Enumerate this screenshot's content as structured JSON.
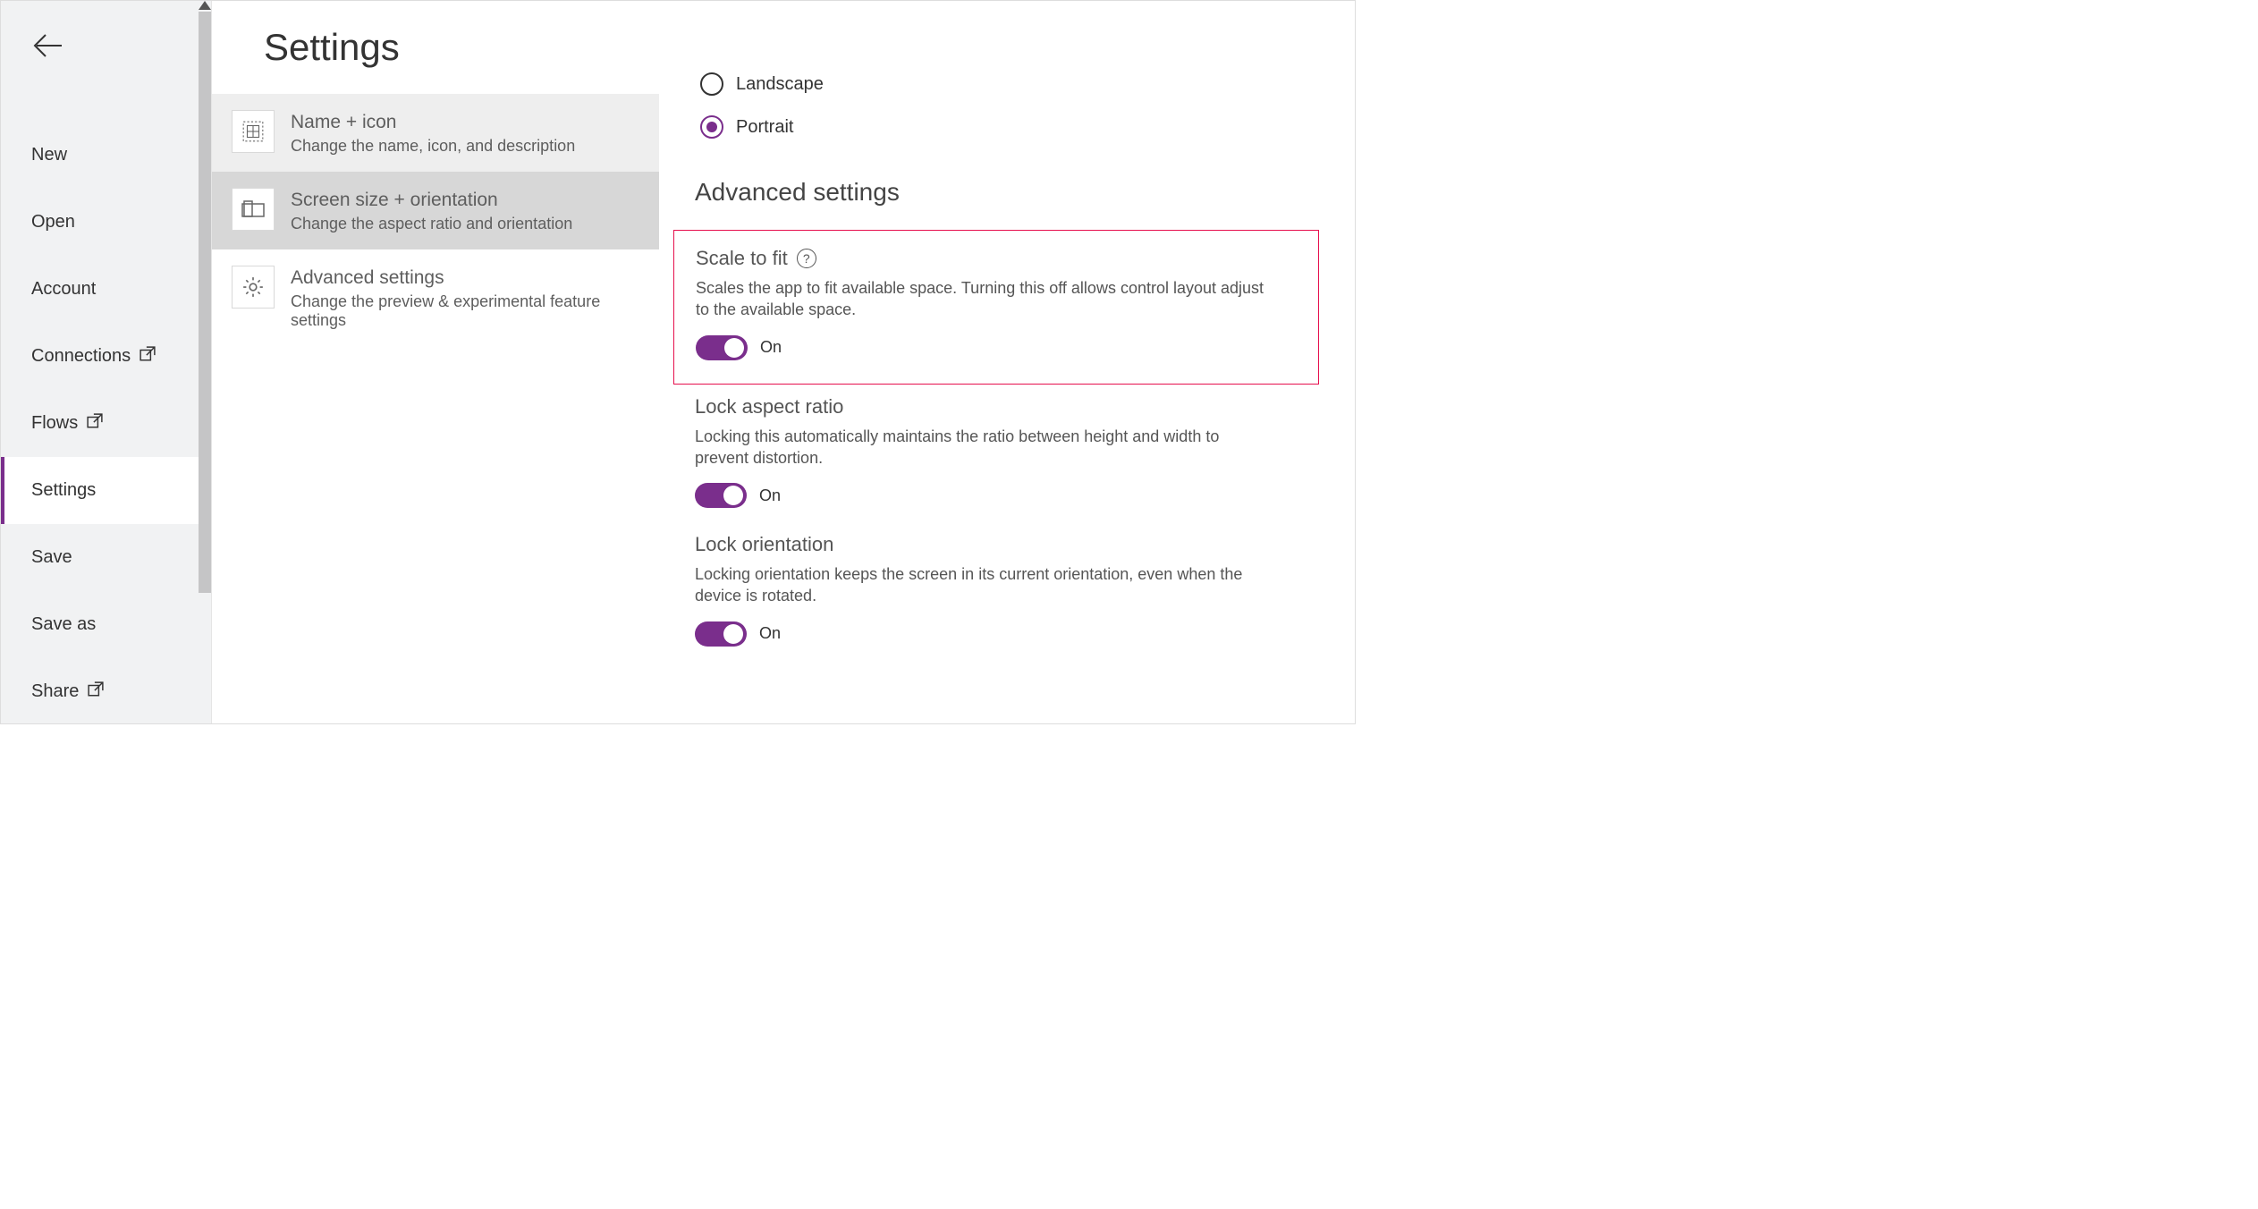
{
  "page_title": "Settings",
  "nav": {
    "items": [
      {
        "label": "New",
        "external": false
      },
      {
        "label": "Open",
        "external": false
      },
      {
        "label": "Account",
        "external": false
      },
      {
        "label": "Connections",
        "external": true
      },
      {
        "label": "Flows",
        "external": true
      },
      {
        "label": "Settings",
        "external": false,
        "active": true
      },
      {
        "label": "Save",
        "external": false
      },
      {
        "label": "Save as",
        "external": false
      },
      {
        "label": "Share",
        "external": true
      }
    ]
  },
  "cards": [
    {
      "title": "Name + icon",
      "desc": "Change the name, icon, and description",
      "state": "hover"
    },
    {
      "title": "Screen size + orientation",
      "desc": "Change the aspect ratio and orientation",
      "state": "selected"
    },
    {
      "title": "Advanced settings",
      "desc": "Change the preview & experimental feature settings",
      "state": ""
    }
  ],
  "orientation": {
    "landscape": "Landscape",
    "portrait": "Portrait",
    "selected": "portrait"
  },
  "advanced": {
    "heading": "Advanced settings",
    "scale": {
      "title": "Scale to fit",
      "desc": "Scales the app to fit available space. Turning this off allows control layout adjust to the available space.",
      "state": "On"
    },
    "aspect": {
      "title": "Lock aspect ratio",
      "desc": "Locking this automatically maintains the ratio between height and width to prevent distortion.",
      "state": "On"
    },
    "lockorient": {
      "title": "Lock orientation",
      "desc": "Locking orientation keeps the screen in its current orientation, even when the device is rotated.",
      "state": "On"
    }
  }
}
